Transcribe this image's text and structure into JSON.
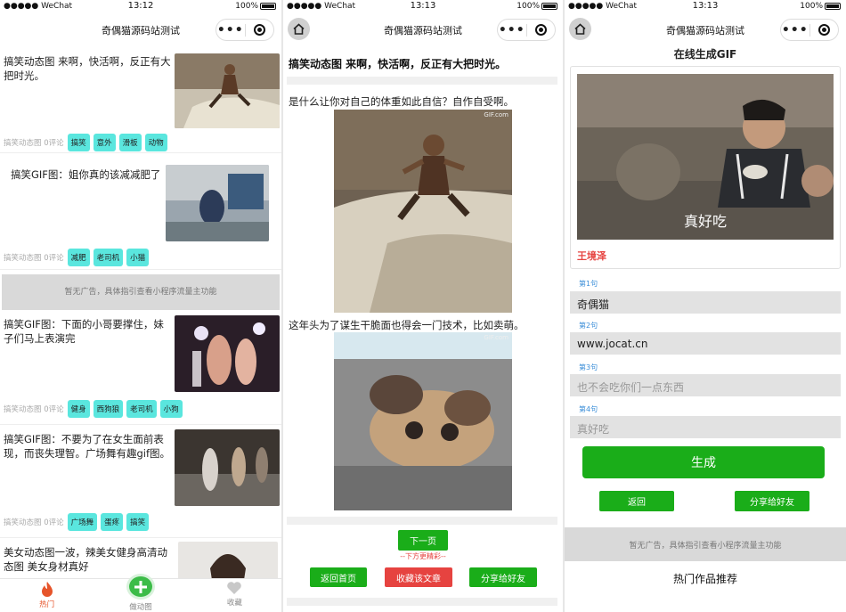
{
  "phones": [
    {
      "status": {
        "carrier": "●●●●● WeChat",
        "time": "13:12",
        "battery": "100%"
      },
      "nav_title": "奇偶猫源码站测试",
      "posts": [
        {
          "title": "搞笑动态图 来啊，快活啊，反正有大把时光。",
          "meta": "搞笑动态图 0评论",
          "tags": [
            "搞笑",
            "意外",
            "滑板",
            "动物"
          ]
        },
        {
          "title": "搞笑GIF图：姐你真的该减减肥了",
          "meta": "搞笑动态图 0评论",
          "tags": [
            "减肥",
            "老司机",
            "小猫"
          ]
        },
        {
          "title": "搞笑GIF图：下面的小哥要撑住，妹子们马上表演完",
          "meta": "搞笑动态图 0评论",
          "tags": [
            "健身",
            "西狗狼",
            "老司机",
            "小狗"
          ]
        },
        {
          "title": "搞笑GIF图：不要为了在女生面前表现，而丧失理智。广场舞有趣gif图。",
          "meta": "搞笑动态图 0评论",
          "tags": [
            "广场舞",
            "蛋疼",
            "搞笑"
          ]
        },
        {
          "title": "美女动态图一波，辣美女健身高清动态图 美女身材真好",
          "meta": "",
          "tags": []
        }
      ],
      "ad_text": "暂无广告，具体指引查看小程序流量主功能",
      "tabbar": {
        "hot": "热门",
        "make": "做动图",
        "fav": "收藏"
      }
    },
    {
      "status": {
        "carrier": "●●●●● WeChat",
        "time": "13:13",
        "battery": "100%"
      },
      "nav_title": "奇偶猫源码站测试",
      "article_title": "搞笑动态图 来啊，快活啊，反正有大把时光。",
      "line1": "是什么让你对自己的体重如此自信？自作自受啊。",
      "line2": "这年头为了谋生干脆面也得会一门技术，比如卖萌。",
      "watermark": "GIF.com",
      "next_btn": "下一页",
      "hint": "--下方更精彩--",
      "btn_home": "返回首页",
      "btn_fav": "收藏该文章",
      "btn_share": "分享给好友"
    },
    {
      "status": {
        "carrier": "●●●●● WeChat",
        "time": "13:13",
        "battery": "100%"
      },
      "nav_title": "奇偶猫源码站测试",
      "title": "在线生成GIF",
      "caption": "真好吃",
      "author": "王境泽",
      "lines": [
        {
          "label": "第1句",
          "value": "奇偶猫",
          "placeholder": false
        },
        {
          "label": "第2句",
          "value": "www.jocat.cn",
          "placeholder": false
        },
        {
          "label": "第3句",
          "value": "也不会吃你们一点东西",
          "placeholder": true
        },
        {
          "label": "第4句",
          "value": "真好吃",
          "placeholder": true
        }
      ],
      "generate_btn": "生成",
      "back_btn": "返回",
      "share_btn": "分享给好友",
      "ad_text": "暂无广告，具体指引查看小程序流量主功能",
      "recommend": "热门作品推荐"
    }
  ]
}
